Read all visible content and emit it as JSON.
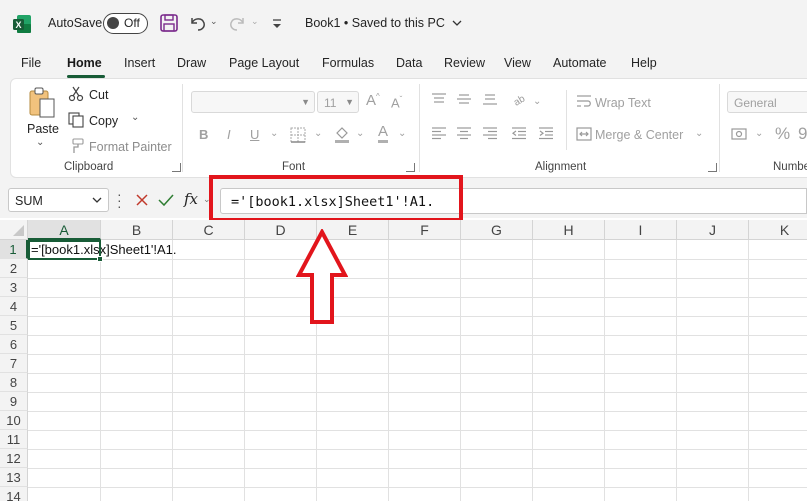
{
  "titlebar": {
    "autosave_label": "AutoSave",
    "autosave_state": "Off",
    "doc_title": "Book1 • Saved to this PC"
  },
  "menu": {
    "tabs": [
      "File",
      "Home",
      "Insert",
      "Draw",
      "Page Layout",
      "Formulas",
      "Data",
      "Review",
      "View",
      "Automate",
      "Help"
    ],
    "active": "Home"
  },
  "ribbon": {
    "clipboard": {
      "paste": "Paste",
      "cut": "Cut",
      "copy": "Copy",
      "format_painter": "Format Painter",
      "label": "Clipboard"
    },
    "font": {
      "font_name": "",
      "font_size": "11",
      "label": "Font"
    },
    "alignment": {
      "wrap_text": "Wrap Text",
      "merge_center": "Merge & Center",
      "label": "Alignment"
    },
    "number": {
      "format": "General",
      "label": "Numbe"
    }
  },
  "formula_bar": {
    "name_box": "SUM",
    "formula": "='[book1.xlsx]Sheet1'!A1."
  },
  "grid": {
    "columns": [
      "A",
      "B",
      "C",
      "D",
      "E",
      "F",
      "G",
      "H",
      "I",
      "J",
      "K"
    ],
    "rows": [
      "1",
      "2",
      "3",
      "4",
      "5",
      "6",
      "7",
      "8",
      "9",
      "10",
      "11",
      "12",
      "13",
      "14"
    ],
    "selected_column": "A",
    "selected_row": "1",
    "a1_value": "='[book1.xlsx]Sheet1'!A1."
  },
  "colors": {
    "excel_green": "#185c37",
    "highlight_red": "#e2151c"
  }
}
